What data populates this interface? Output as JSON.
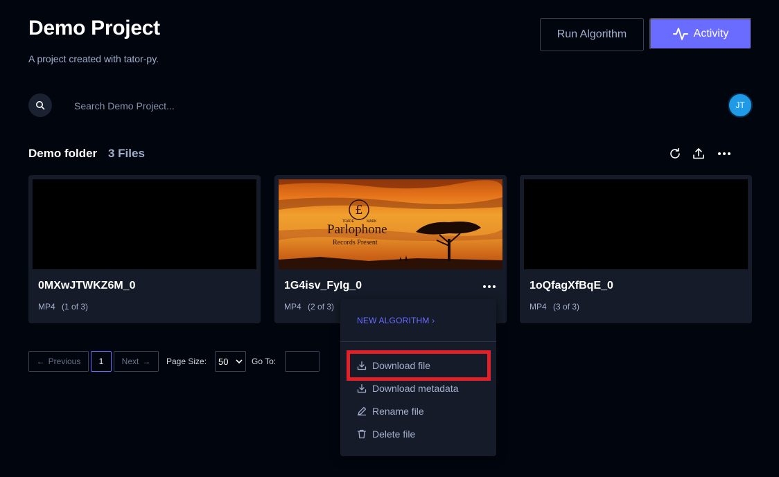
{
  "project": {
    "title": "Demo Project",
    "description": "A project created with tator-py."
  },
  "header": {
    "run_algorithm_label": "Run Algorithm",
    "activity_label": "Activity"
  },
  "search": {
    "placeholder": "Search Demo Project..."
  },
  "user": {
    "initials": "JT"
  },
  "folder": {
    "name": "Demo folder",
    "count": "3 Files"
  },
  "files": [
    {
      "name": "0MXwJTWKZ6M_0",
      "type": "MP4",
      "position": "(1 of 3)"
    },
    {
      "name": "1G4isv_FyIg_0",
      "type": "MP4",
      "position": "(2 of 3)",
      "thumb_text": "Parlophone",
      "thumb_sub": "Records Present",
      "thumb_small_left": "TRADE",
      "thumb_small_right": "MARK"
    },
    {
      "name": "1oQfagXfBqE_0",
      "type": "MP4",
      "position": "(3 of 3)"
    }
  ],
  "pagination": {
    "previous_label": "Previous",
    "current_page": "1",
    "next_label": "Next",
    "page_size_label": "Page Size:",
    "page_size_value": "50",
    "goto_label": "Go To:"
  },
  "context_menu": {
    "new_algorithm": "NEW ALGORITHM",
    "items": [
      {
        "label": "Download file",
        "icon": "download-icon"
      },
      {
        "label": "Download metadata",
        "icon": "download-icon"
      },
      {
        "label": "Rename file",
        "icon": "pencil-icon"
      },
      {
        "label": "Delete file",
        "icon": "trash-icon"
      }
    ]
  },
  "colors": {
    "accent": "#696cff",
    "background": "#00050e",
    "card": "#151b28",
    "highlight": "#e32028",
    "avatar": "#1f9ae6"
  }
}
